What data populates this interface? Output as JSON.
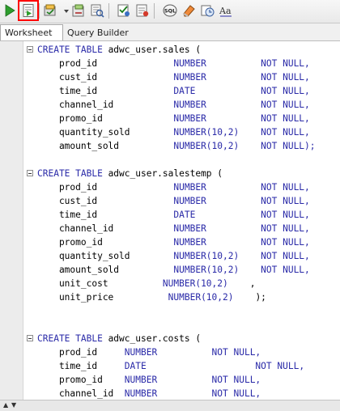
{
  "toolbar": {
    "buttons": [
      {
        "name": "run-statement-button",
        "icon": "play-green-icon"
      },
      {
        "name": "run-script-button",
        "icon": "script-run-icon",
        "highlighted": true
      },
      {
        "name": "commit-button",
        "icon": "commit-icon"
      },
      {
        "name": "rollback-button",
        "icon": "rollback-icon"
      },
      {
        "name": "explain-plan-button",
        "icon": "explain-plan-icon"
      },
      {
        "name": "autotrace-button",
        "icon": "autotrace-icon"
      },
      {
        "name": "sql-tuning-button",
        "icon": "sql-tuning-icon",
        "text": "SQL"
      },
      {
        "name": "clear-button",
        "icon": "eraser-icon"
      },
      {
        "name": "history-button",
        "icon": "history-icon"
      },
      {
        "name": "format-button",
        "icon": "text-case-icon",
        "text": "Aa"
      }
    ]
  },
  "tabs": [
    {
      "label": "Worksheet",
      "active": true
    },
    {
      "label": "Query Builder",
      "active": false
    }
  ],
  "colors": {
    "keyword": "#2a2aa8",
    "identifier": "#000000",
    "highlight": "#ff0000"
  },
  "code": {
    "lines": [
      [
        {
          "t": "CREATE TABLE ",
          "k": true
        },
        {
          "t": "adwc_user.sales (",
          "k": false
        }
      ],
      [
        {
          "t": "    prod_id              ",
          "k": false
        },
        {
          "t": "NUMBER          NOT NULL,",
          "k": true
        }
      ],
      [
        {
          "t": "    cust_id              ",
          "k": false
        },
        {
          "t": "NUMBER          NOT NULL,",
          "k": true
        }
      ],
      [
        {
          "t": "    time_id              ",
          "k": false
        },
        {
          "t": "DATE            NOT NULL,",
          "k": true
        }
      ],
      [
        {
          "t": "    channel_id           ",
          "k": false
        },
        {
          "t": "NUMBER          NOT NULL,",
          "k": true
        }
      ],
      [
        {
          "t": "    promo_id             ",
          "k": false
        },
        {
          "t": "NUMBER          NOT NULL,",
          "k": true
        }
      ],
      [
        {
          "t": "    quantity_sold        ",
          "k": false
        },
        {
          "t": "NUMBER(10,2)    NOT NULL,",
          "k": true
        }
      ],
      [
        {
          "t": "    amount_sold          ",
          "k": false
        },
        {
          "t": "NUMBER(10,2)    NOT NULL);",
          "k": true
        }
      ],
      [],
      [
        {
          "t": "CREATE TABLE ",
          "k": true
        },
        {
          "t": "adwc_user.salestemp (",
          "k": false
        }
      ],
      [
        {
          "t": "    prod_id              ",
          "k": false
        },
        {
          "t": "NUMBER          NOT NULL,",
          "k": true
        }
      ],
      [
        {
          "t": "    cust_id              ",
          "k": false
        },
        {
          "t": "NUMBER          NOT NULL,",
          "k": true
        }
      ],
      [
        {
          "t": "    time_id              ",
          "k": false
        },
        {
          "t": "DATE            NOT NULL,",
          "k": true
        }
      ],
      [
        {
          "t": "    channel_id           ",
          "k": false
        },
        {
          "t": "NUMBER          NOT NULL,",
          "k": true
        }
      ],
      [
        {
          "t": "    promo_id             ",
          "k": false
        },
        {
          "t": "NUMBER          NOT NULL,",
          "k": true
        }
      ],
      [
        {
          "t": "    quantity_sold        ",
          "k": false
        },
        {
          "t": "NUMBER(10,2)    NOT NULL,",
          "k": true
        }
      ],
      [
        {
          "t": "    amount_sold          ",
          "k": false
        },
        {
          "t": "NUMBER(10,2)    NOT NULL,",
          "k": true
        }
      ],
      [
        {
          "t": "    unit_cost          ",
          "k": false
        },
        {
          "t": "NUMBER(10,2)    ",
          "k": true
        },
        {
          "t": ",",
          "k": false
        }
      ],
      [
        {
          "t": "    unit_price          ",
          "k": false
        },
        {
          "t": "NUMBER(10,2)    ",
          "k": true
        },
        {
          "t": ");",
          "k": false
        }
      ],
      [],
      [],
      [
        {
          "t": "CREATE TABLE ",
          "k": true
        },
        {
          "t": "adwc_user.costs (",
          "k": false
        }
      ],
      [
        {
          "t": "    prod_id     ",
          "k": false
        },
        {
          "t": "NUMBER          NOT NULL,",
          "k": true
        }
      ],
      [
        {
          "t": "    time_id     ",
          "k": false
        },
        {
          "t": "DATE                    NOT NULL,",
          "k": true
        }
      ],
      [
        {
          "t": "    promo_id    ",
          "k": false
        },
        {
          "t": "NUMBER          NOT NULL,",
          "k": true
        }
      ],
      [
        {
          "t": "    channel_id  ",
          "k": false
        },
        {
          "t": "NUMBER          NOT NULL,",
          "k": true
        }
      ]
    ]
  }
}
